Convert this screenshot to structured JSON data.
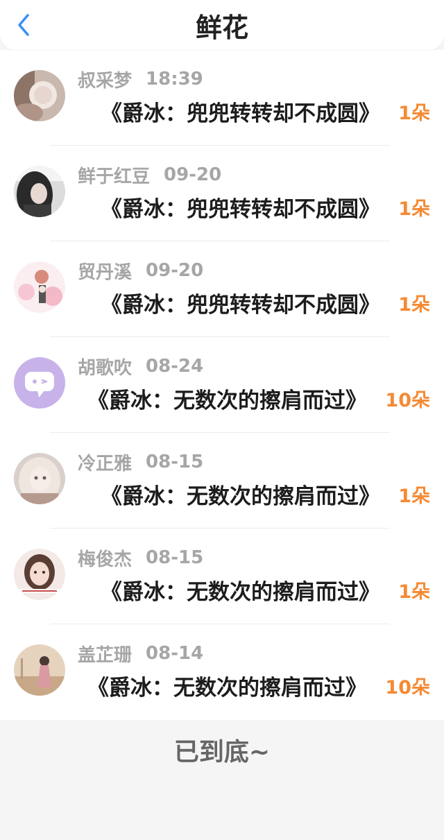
{
  "header": {
    "title": "鲜花",
    "back_icon": "chevron-left-icon",
    "accent_color": "#3a8ff5"
  },
  "items": [
    {
      "name": "叔采梦",
      "time": "18:39",
      "gift": "《爵冰：兜兜转转却不成圆》",
      "count": "1朵"
    },
    {
      "name": "鲜于红豆",
      "time": "09-20",
      "gift": "《爵冰：兜兜转转却不成圆》",
      "count": "1朵"
    },
    {
      "name": "贸丹溪",
      "time": "09-20",
      "gift": "《爵冰：兜兜转转却不成圆》",
      "count": "1朵"
    },
    {
      "name": "胡歌吹",
      "time": "08-24",
      "gift": "《爵冰：无数次的擦肩而过》",
      "count": "10朵"
    },
    {
      "name": "冷正雅",
      "time": "08-15",
      "gift": "《爵冰：无数次的擦肩而过》",
      "count": "1朵"
    },
    {
      "name": "梅俊杰",
      "time": "08-15",
      "gift": "《爵冰：无数次的擦肩而过》",
      "count": "1朵"
    },
    {
      "name": "盖芷珊",
      "time": "08-14",
      "gift": "《爵冰：无数次的擦肩而过》",
      "count": "10朵"
    }
  ],
  "footer": {
    "end_text": "已到底~"
  },
  "colors": {
    "count": "#f58a33",
    "meta": "#a6a6a6",
    "background": "#f6f5f6"
  }
}
